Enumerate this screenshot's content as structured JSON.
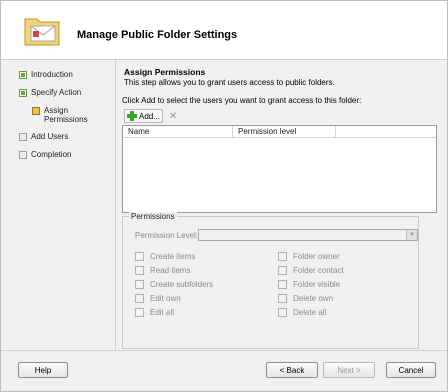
{
  "header": {
    "title": "Manage Public Folder Settings",
    "icon": "folder-envelope-icon"
  },
  "nav": [
    {
      "label": "Introduction",
      "state": "done"
    },
    {
      "label": "Specify Action",
      "state": "done"
    },
    {
      "label": "Assign Permissions",
      "state": "active"
    },
    {
      "label": "Add Users",
      "state": "pending"
    },
    {
      "label": "Completion",
      "state": "pending"
    }
  ],
  "content": {
    "section_title": "Assign Permissions",
    "description": "This step allows you to grant users access to public folders.",
    "instruction": "Click Add to select the users you want to grant access to this folder:",
    "add_label": "Add...",
    "remove_label": "✕",
    "columns": [
      "Name",
      "Permission level"
    ]
  },
  "permissions": {
    "legend": "Permissions",
    "level_label": "Permission Level:",
    "level_value": "",
    "left": [
      "Create items",
      "Read items",
      "Create subfolders",
      "Edit own",
      "Edit all"
    ],
    "right": [
      "Folder owner",
      "Folder contact",
      "Folder visible",
      "Delete own",
      "Delete all"
    ]
  },
  "buttons": {
    "help": "Help",
    "back": "< Back",
    "next": "Next >",
    "cancel": "Cancel"
  }
}
